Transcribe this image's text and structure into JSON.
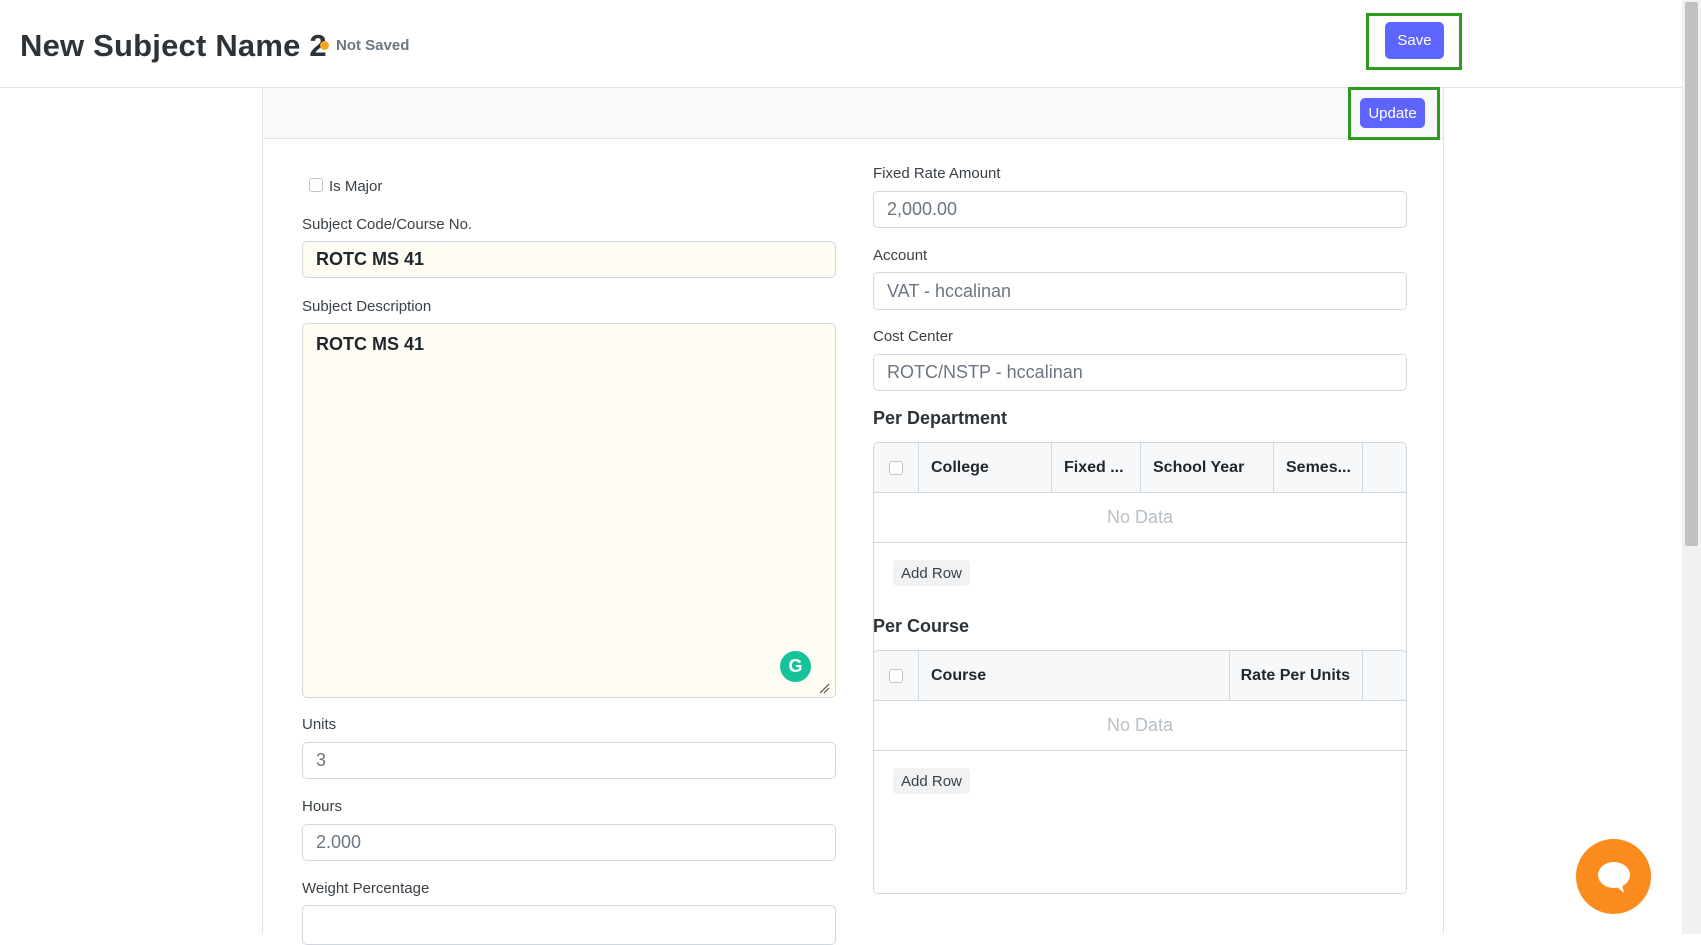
{
  "header": {
    "title": "New Subject Name 2",
    "status": "Not Saved",
    "save_label": "Save"
  },
  "card": {
    "update_label": "Update"
  },
  "left": {
    "is_major_label": "Is Major",
    "is_major_checked": false,
    "subject_code": {
      "label": "Subject Code/Course No.",
      "value": "ROTC MS 41"
    },
    "subject_description": {
      "label": "Subject Description",
      "value": "ROTC MS 41"
    },
    "units": {
      "label": "Units",
      "value": "3"
    },
    "hours": {
      "label": "Hours",
      "value": "2.000"
    },
    "weight_percentage": {
      "label": "Weight Percentage",
      "value": ""
    }
  },
  "right": {
    "fixed_rate_amount": {
      "label": "Fixed Rate Amount",
      "value": "2,000.00"
    },
    "account": {
      "label": "Account",
      "value": "VAT - hccalinan"
    },
    "cost_center": {
      "label": "Cost Center",
      "value": "ROTC/NSTP - hccalinan"
    },
    "per_department": {
      "title": "Per Department",
      "columns": [
        "College",
        "Fixed ...",
        "School Year",
        "Semes..."
      ],
      "no_data": "No Data",
      "add_row": "Add Row"
    },
    "per_course": {
      "title": "Per Course",
      "columns": [
        "Course",
        "Rate Per Units"
      ],
      "no_data": "No Data",
      "add_row": "Add Row"
    }
  },
  "colors": {
    "primary": "#5e64ff",
    "highlight": "#2e9b1e",
    "status_dot": "#f5a623",
    "chat": "#fa8b1c",
    "grammarly": "#15c39a"
  },
  "icons": [
    "status-dot-icon",
    "grammarly-icon",
    "resize-grip-icon",
    "chat-icon"
  ]
}
